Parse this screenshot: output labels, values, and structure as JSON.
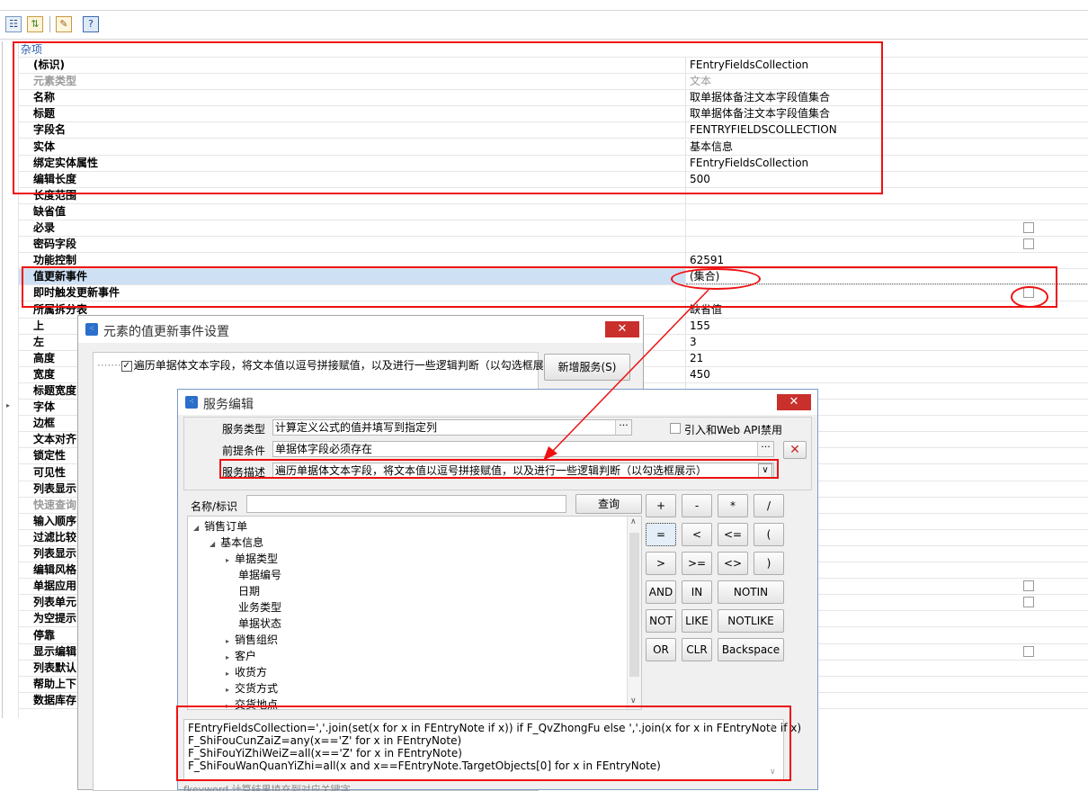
{
  "toolbar": {
    "icons": [
      "categorized-icon",
      "sort-icon",
      "property-page-icon",
      "help-icon"
    ]
  },
  "property_grid": {
    "category": "杂项",
    "rows": [
      {
        "name": "(标识)",
        "value": "FEntryFieldsCollection"
      },
      {
        "name": "元素类型",
        "value": "文本"
      },
      {
        "name": "名称",
        "value": "取单据体备注文本字段值集合"
      },
      {
        "name": "标题",
        "value": "取单据体备注文本字段值集合"
      },
      {
        "name": "字段名",
        "value": "FENTRYFIELDSCOLLECTION"
      },
      {
        "name": "实体",
        "value": "基本信息"
      },
      {
        "name": "绑定实体属性",
        "value": "FEntryFieldsCollection"
      },
      {
        "name": "编辑长度",
        "value": "500"
      },
      {
        "name": "长度范围",
        "value": ""
      },
      {
        "name": "缺省值",
        "value": ""
      },
      {
        "name": "必录",
        "value": ""
      },
      {
        "name": "密码字段",
        "value": ""
      },
      {
        "name": "功能控制",
        "value": "62591"
      },
      {
        "name": "值更新事件",
        "value": "(集合)"
      },
      {
        "name": "即时触发更新事件",
        "value": ""
      },
      {
        "name": "所属拆分表",
        "value": "缺省值"
      },
      {
        "name": "上",
        "value": "155"
      },
      {
        "name": "左",
        "value": "3"
      },
      {
        "name": "高度",
        "value": "21"
      },
      {
        "name": "宽度",
        "value": "450"
      },
      {
        "name": "标题宽度",
        "value": ""
      },
      {
        "name": "字体",
        "value": ""
      },
      {
        "name": "边框",
        "value": ""
      },
      {
        "name": "文本对齐",
        "value": ""
      },
      {
        "name": "锁定性",
        "value": ""
      },
      {
        "name": "可见性",
        "value": ""
      },
      {
        "name": "列表显示",
        "value": ""
      },
      {
        "name": "快速查询",
        "value": ""
      },
      {
        "name": "输入顺序",
        "value": ""
      },
      {
        "name": "过滤比较",
        "value": ""
      },
      {
        "name": "列表显示",
        "value": ""
      },
      {
        "name": "编辑风格",
        "value": ""
      },
      {
        "name": "单据应用",
        "value": ""
      },
      {
        "name": "列表单元",
        "value": ""
      },
      {
        "name": "为空提示",
        "value": ""
      },
      {
        "name": "停靠",
        "value": ""
      },
      {
        "name": "显示编辑",
        "value": ""
      },
      {
        "name": "列表默认",
        "value": ""
      },
      {
        "name": "帮助上下",
        "value": ""
      },
      {
        "name": "数据库存",
        "value": ""
      }
    ]
  },
  "event_dialog": {
    "title": "元素的值更新事件设置",
    "close": "✕",
    "item_label": "遍历单据体文本字段，将文本值以逗号拼接赋值，以及进行一些逻辑判断（以勾选框展",
    "add_service_button": "新增服务(S)"
  },
  "service_dialog": {
    "title": "服务编辑",
    "close": "✕",
    "service_type_label": "服务类型",
    "service_type_value": "计算定义公式的值并填写到指定列",
    "webapi_label": "引入和Web API禁用",
    "precondition_label": "前提条件",
    "precondition_value": "单据体字段必须存在",
    "desc_label": "服务描述",
    "desc_value": "遍历单据体文本字段，将文本值以逗号拼接赋值，以及进行一些逻辑判断（以勾选框展示）",
    "search_label": "名称/标识",
    "search_value": "",
    "search_button": "查询",
    "tree": [
      {
        "label": "销售订单",
        "level": 0,
        "arrow": "◢"
      },
      {
        "label": "基本信息",
        "level": 1,
        "arrow": "◢"
      },
      {
        "label": "单据类型",
        "level": 2,
        "arrow": "▸"
      },
      {
        "label": "单据编号",
        "level": 2,
        "arrow": ""
      },
      {
        "label": "日期",
        "level": 2,
        "arrow": ""
      },
      {
        "label": "业务类型",
        "level": 2,
        "arrow": ""
      },
      {
        "label": "单据状态",
        "level": 2,
        "arrow": ""
      },
      {
        "label": "销售组织",
        "level": 2,
        "arrow": "▸"
      },
      {
        "label": "客户",
        "level": 2,
        "arrow": "▸"
      },
      {
        "label": "收货方",
        "level": 2,
        "arrow": "▸"
      },
      {
        "label": "交货方式",
        "level": 2,
        "arrow": "▸"
      },
      {
        "label": "交货地点",
        "level": 2,
        "arrow": "▸"
      }
    ],
    "keypad": [
      [
        "+",
        "-",
        "*",
        "/"
      ],
      [
        "=",
        "<",
        "<=",
        "("
      ],
      [
        ">",
        ">=",
        "<>",
        ")"
      ],
      [
        "AND",
        "IN",
        "NOTIN"
      ],
      [
        "NOT",
        "LIKE",
        "NOTLIKE"
      ],
      [
        "OR",
        "CLR",
        "Backspace"
      ]
    ],
    "formula_lines": [
      "FEntryFieldsCollection=','.join(set(x for x in FEntryNote if x)) if F_QvZhongFu else ','.join(x for x in FEntryNote if x)",
      "F_ShiFouCunZaiZ=any(x=='Z' for x in FEntryNote)",
      "F_ShiFouYiZhiWeiZ=all(x=='Z' for x in FEntryNote)",
      "F_ShiFouWanQuanYiZhi=all(x and x==FEntryNote.TargetObjects[0] for x in FEntryNote)"
    ],
    "bottom_hint": "fkeyword  计算结果填充到对应关键字"
  },
  "colors": {
    "annotation": "#e11111",
    "selected_row": "#cde0f4",
    "category": "#2a5db0"
  }
}
